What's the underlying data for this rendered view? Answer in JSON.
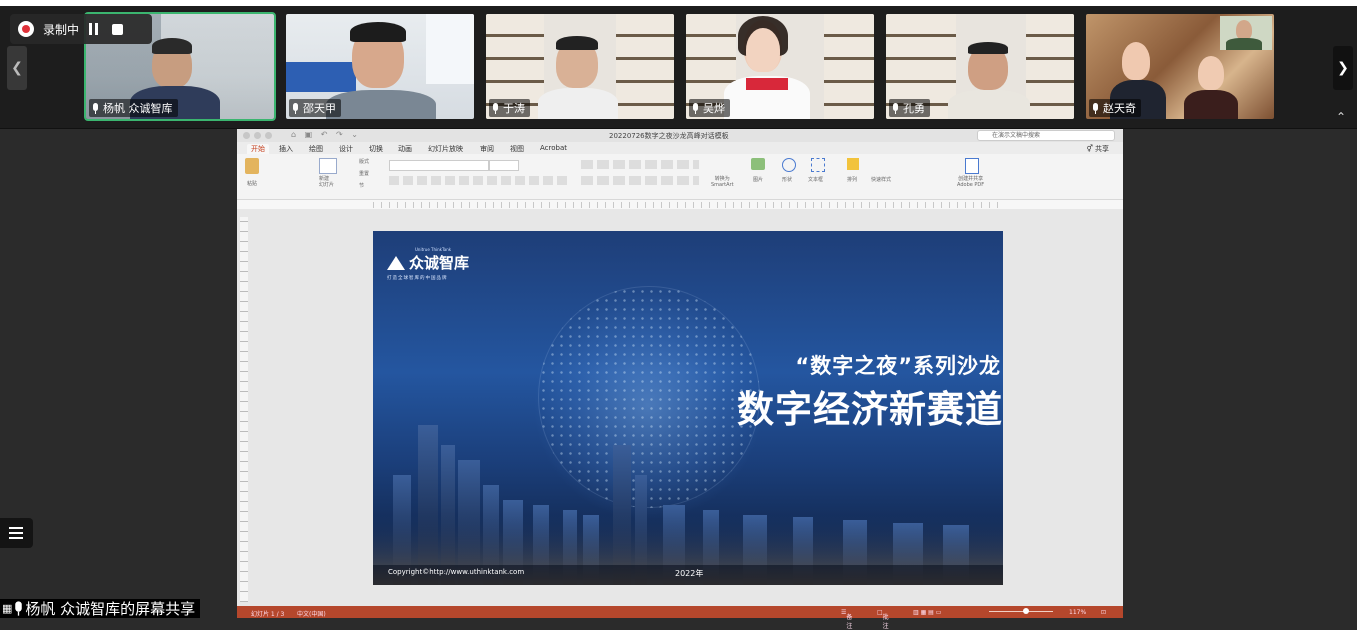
{
  "recording": {
    "label": "录制中"
  },
  "participants": [
    {
      "name": "杨帆 众诚智库",
      "active": true
    },
    {
      "name": "邵天甲",
      "active": false
    },
    {
      "name": "于涛",
      "active": false
    },
    {
      "name": "吴烨",
      "active": false
    },
    {
      "name": "孔勇",
      "active": false
    },
    {
      "name": "赵天奇",
      "active": false
    }
  ],
  "ppt": {
    "title": "20220726数字之夜沙龙高峰对话模板",
    "search_placeholder": "在演示文稿中搜索",
    "share_label": "共享",
    "tabs": [
      "开始",
      "插入",
      "绘图",
      "设计",
      "切换",
      "动画",
      "幻灯片放映",
      "审阅",
      "视图",
      "Acrobat"
    ],
    "ribbon": {
      "paste": "粘贴",
      "new_slide": "新建\n幻灯片",
      "layout": "版式",
      "reset": "重置",
      "section": "节",
      "convert_smartart": "转换为\nSmartArt",
      "picture": "图片",
      "shapes": "形状",
      "textbox": "文本框",
      "arrange": "排列",
      "quick_styles": "快速样式",
      "create_pdf": "创建并共享\nAdobe PDF"
    },
    "status": {
      "slide_count": "幻灯片 1 / 3",
      "language": "中文(中国)",
      "notes": "备注",
      "comments": "批注",
      "zoom": "117%"
    }
  },
  "slide": {
    "logo_en": "Unitrue ThinkTank",
    "logo_cn": "众诚智库",
    "logo_slogan": "打造全球智库的中国品牌",
    "subtitle": "“数字之夜”系列沙龙",
    "headline": "数字经济新赛道",
    "copyright": "Copyright©http://www.uthinktank.com",
    "year": "2022年"
  },
  "share_label": "杨帆 众诚智库的屏幕共享"
}
